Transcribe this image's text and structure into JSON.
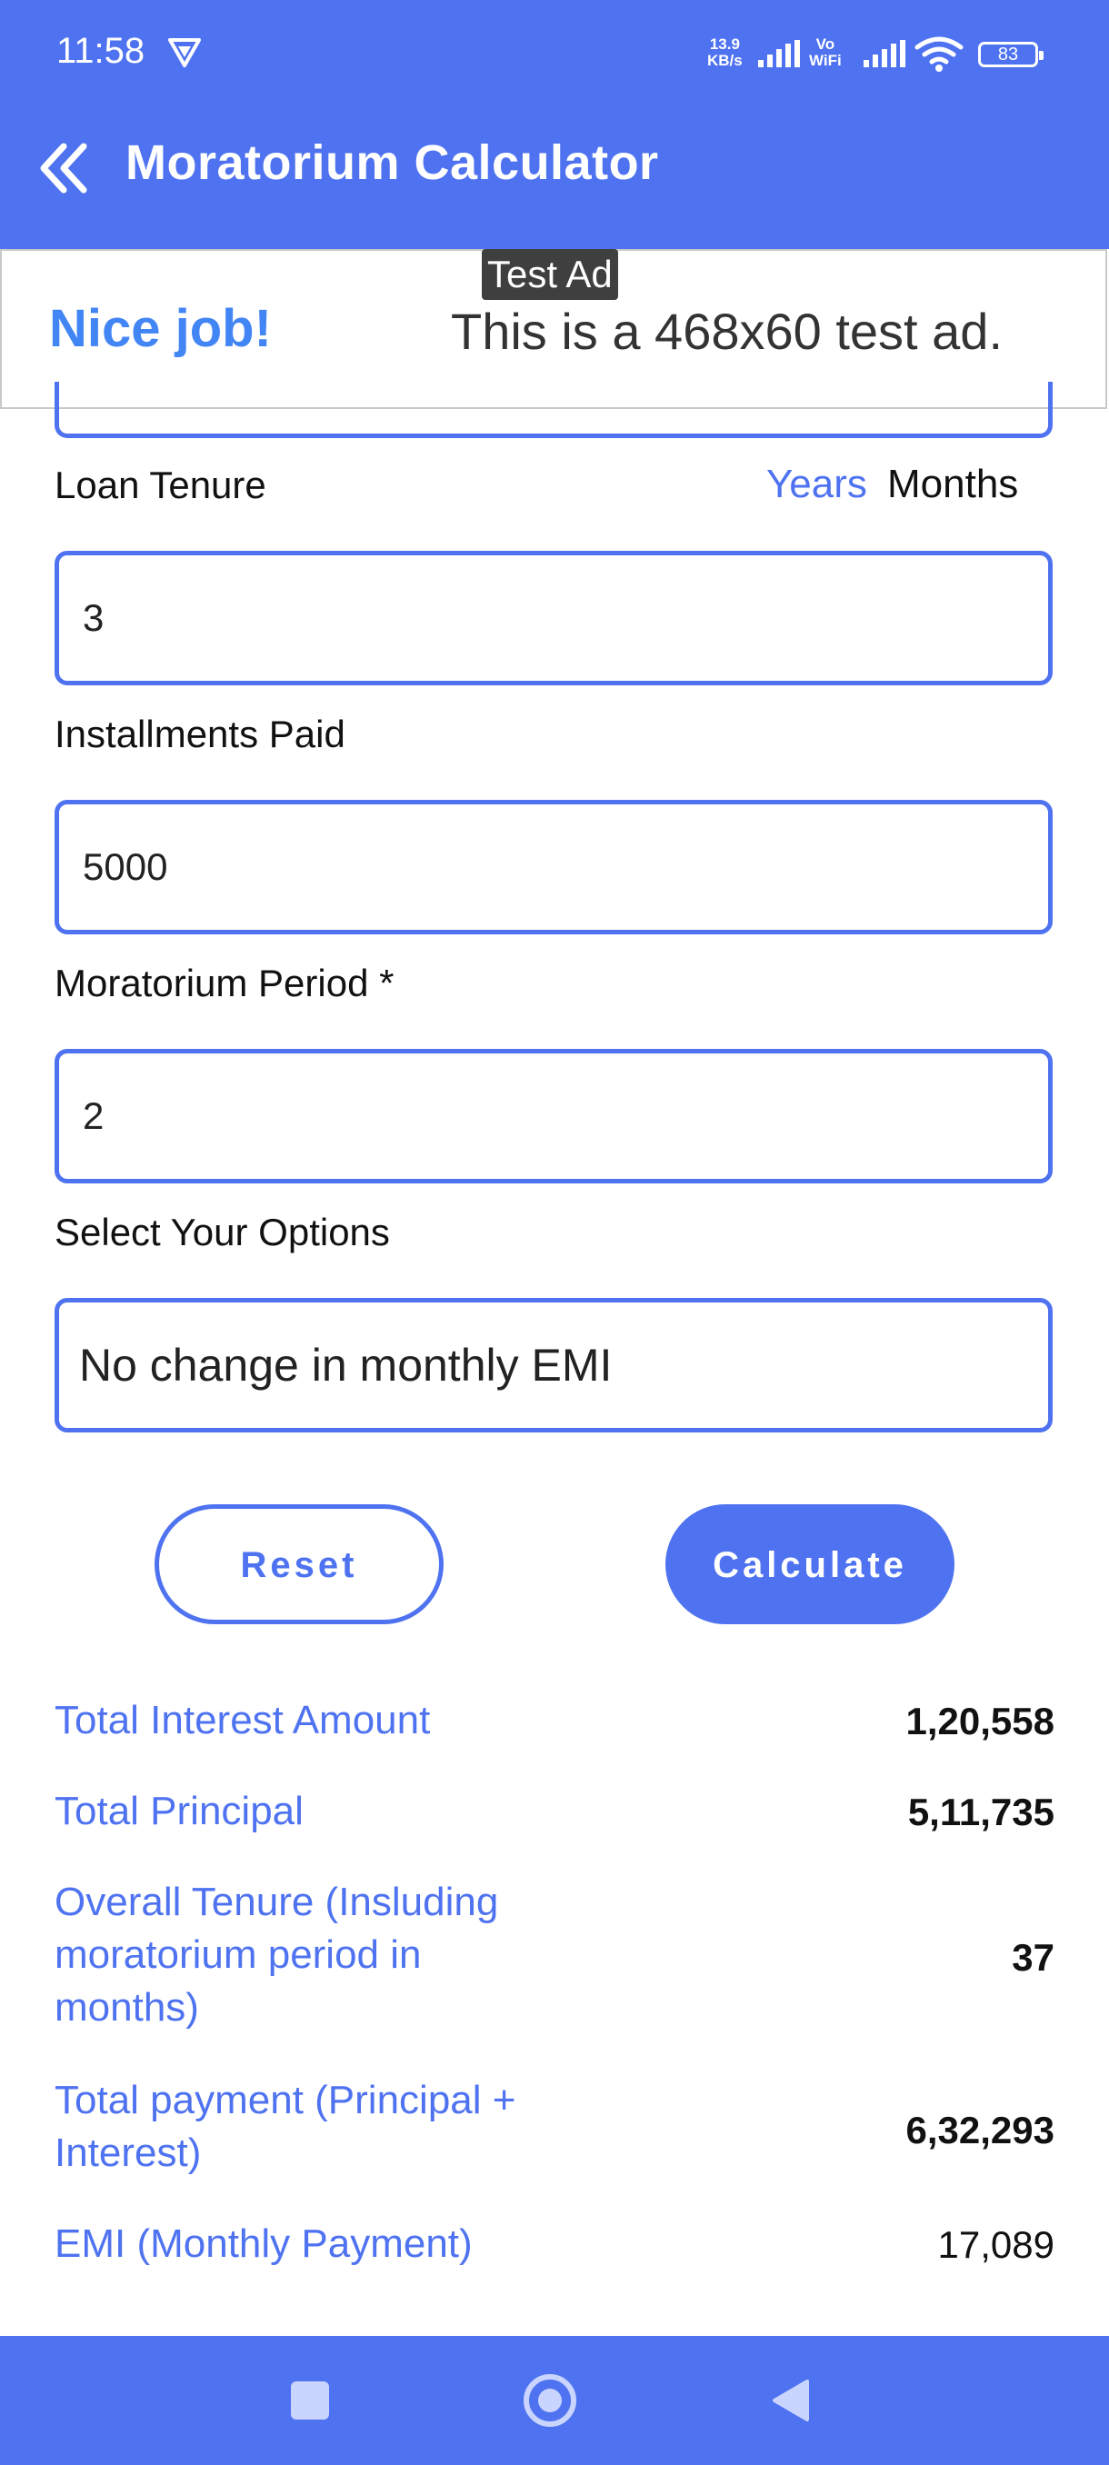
{
  "status_bar": {
    "time": "11:58",
    "net_speed_value": "13.9",
    "net_speed_unit": "KB/s",
    "vo_label": "Vo",
    "wifi_label": "WiFi",
    "battery": "83"
  },
  "app_bar": {
    "title": "Moratorium Calculator"
  },
  "ad": {
    "tag": "Test Ad",
    "headline": "Nice job!",
    "text": "This is a 468x60 test ad."
  },
  "form": {
    "tenure_label": "Loan Tenure",
    "unit_years": "Years",
    "unit_months": "Months",
    "tenure_value": "3",
    "paid_label": "Installments Paid",
    "paid_value": "5000",
    "moratorium_label": "Moratorium Period *",
    "moratorium_value": "2",
    "options_label": "Select Your Options",
    "options_value": "No change in monthly EMI"
  },
  "buttons": {
    "reset": "Reset",
    "calculate": "Calculate"
  },
  "results": [
    {
      "label": "Total Interest Amount",
      "value": "1,20,558"
    },
    {
      "label": "Total Principal",
      "value": "5,11,735"
    },
    {
      "label": "Overall Tenure (Insluding moratorium period in months)",
      "value": "37"
    },
    {
      "label": "Total payment (Principal + Interest)",
      "value": "6,32,293"
    },
    {
      "label": "EMI (Monthly Payment)",
      "value": "17,089"
    }
  ],
  "colors": {
    "primary": "#4f73f0",
    "ad_headline": "#4285f4"
  }
}
